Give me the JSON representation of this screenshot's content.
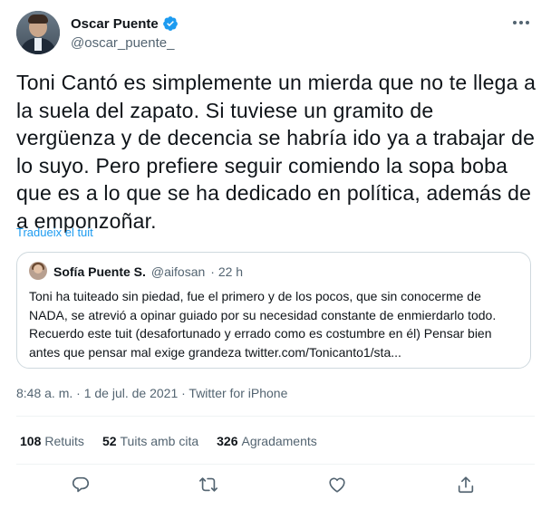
{
  "author": {
    "name": "Oscar Puente",
    "handle": "@oscar_puente_"
  },
  "tweet_text": "Toni Cantó es simplemente un mierda que no te llega a la suela del zapato. Si tuviese un gramito de vergüenza y de decencia se habría ido ya a trabajar de lo suyo. Pero prefiere seguir comiendo la sopa boba que es a lo que se ha dedicado en política, además de a emponzoñar.",
  "translate_label": "Tradueix el tuit",
  "quote": {
    "name": "Sofía Puente S.",
    "handle": "@aifosan",
    "time": "· 22 h",
    "text": "Toni ha tuiteado sin piedad, fue el primero y de los pocos, que sin conocerme de NADA, se atrevió a opinar guiado por su necesidad constante de enmierdarlo todo.  Recuerdo este tuit (desafortunado y errado como es costumbre en él) Pensar bien antes que pensar mal exige grandeza twitter.com/Tonicanto1/sta..."
  },
  "meta": "8:48 a. m. · 1 de jul. de 2021 · Twitter for iPhone",
  "stats": {
    "retweets_count": "108",
    "retweets_label": "Retuits",
    "quotes_count": "52",
    "quotes_label": "Tuits amb cita",
    "likes_count": "326",
    "likes_label": "Agradaments"
  },
  "colors": {
    "accent": "#1d9bf0",
    "secondary_text": "#536471",
    "border": "#cfd9de"
  },
  "icons": {
    "verified": "verified-badge-icon",
    "more": "more-dots-icon",
    "reply": "reply-icon",
    "retweet": "retweet-icon",
    "like": "heart-icon",
    "share": "share-icon"
  }
}
